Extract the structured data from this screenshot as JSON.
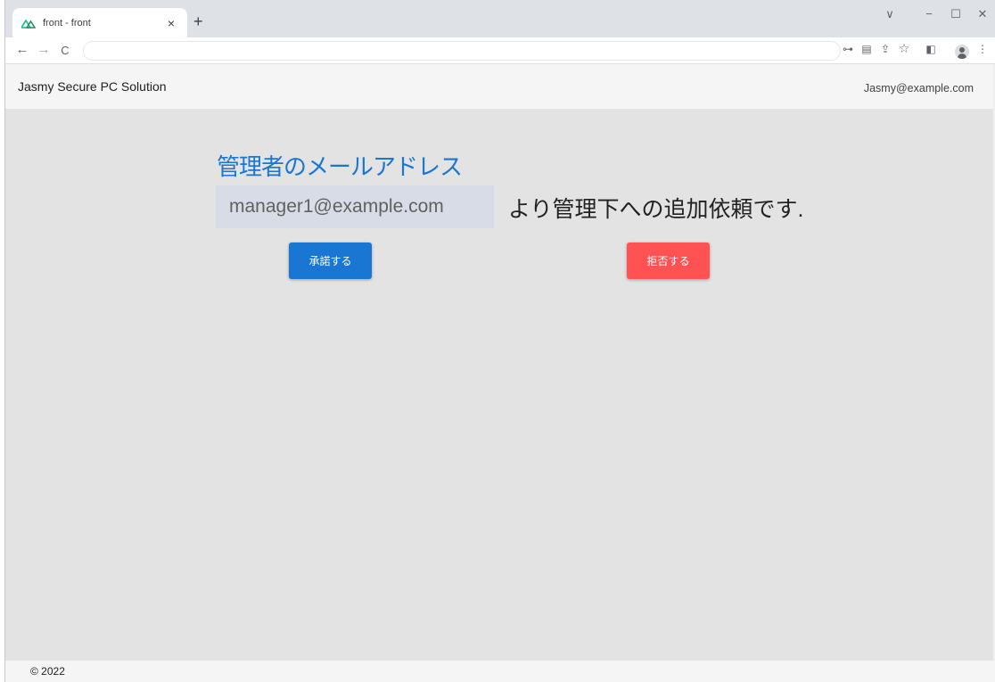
{
  "browser": {
    "tab_title": "front - front",
    "tab_close": "×",
    "new_tab": "+",
    "window_controls": {
      "dropdown": "∨",
      "minimize": "−",
      "maximize": "☐",
      "close": "✕"
    },
    "nav": {
      "back": "←",
      "forward": "→",
      "reload": "C"
    },
    "url": "",
    "toolbar_icons": [
      "key-icon",
      "translate-icon",
      "share-icon",
      "star-icon",
      "side-panel-icon",
      "profile-icon",
      "menu-icon"
    ],
    "toolbar_glyphs": {
      "key": "⊶",
      "translate": "▤",
      "share": "⇪",
      "star": "☆",
      "side_panel": "◧",
      "menu": "⋮"
    }
  },
  "app": {
    "title": "Jasmy Secure PC Solution",
    "user_email": "Jasmy@example.com"
  },
  "main": {
    "heading": "管理者のメールアドレス",
    "manager_email": "manager1@example.com",
    "request_text": "より管理下への追加依頼です.",
    "approve_label": "承諾する",
    "reject_label": "拒否する"
  },
  "footer": {
    "copyright": "© 2022"
  },
  "colors": {
    "accent": "#1976d2",
    "danger": "#ff5252",
    "background": "#e3e3e3",
    "appbar": "#f5f5f5"
  }
}
